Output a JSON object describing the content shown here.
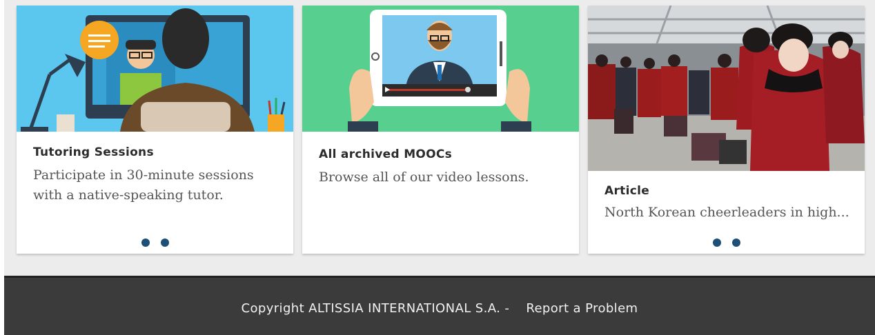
{
  "cards": [
    {
      "title": "Tutoring Sessions",
      "text": "Participate in 30-minute sessions with a native-speaking tutor.",
      "dots": 2
    },
    {
      "title": "All archived MOOCs",
      "text": "Browse all of our video lessons.",
      "dots": 0
    },
    {
      "title": "Article",
      "text": "North Korean cheerleaders in high...",
      "dots": 2
    }
  ],
  "footer": {
    "copyright": "Copyright ALTISSIA INTERNATIONAL S.A. -",
    "report_link": "Report a Problem"
  },
  "colors": {
    "tutoring_bg": "#5bc6ee",
    "mooc_bg": "#57cf8e",
    "dot": "#1d4f77",
    "footer_bg": "#3b3b3b"
  }
}
